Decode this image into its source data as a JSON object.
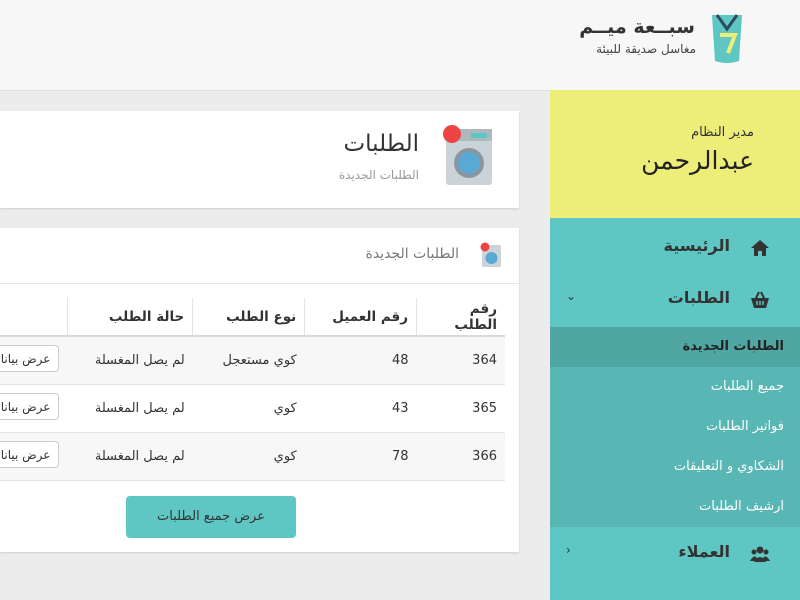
{
  "brand": {
    "name": "سبــعة ميــم",
    "tagline": "مغاسل صديقة للبيئة"
  },
  "profile": {
    "role": "مدير النظام",
    "name": "عبدالرحمن"
  },
  "sidebar": {
    "home_label": "الرئيسية",
    "orders_label": "الطلبات",
    "orders_sub": [
      "الطلبات الجديدة",
      "جميع الطلبات",
      "فواتير الطلبات",
      "الشكاوي و التعليقات",
      "ارشيف الطلبات"
    ],
    "clients_label": "العملاء"
  },
  "page": {
    "title": "الطلبات",
    "subtitle": "الطلبات الجديدة"
  },
  "panel": {
    "title": "الطلبات الجديدة"
  },
  "table": {
    "headers": [
      "رقم الطلب",
      "رقم العميل",
      "نوع الطلب",
      "حالة الطلب"
    ],
    "rows": [
      {
        "order_id": "364",
        "client_id": "48",
        "type": "كوي مستعجل",
        "status": "لم يصل المغسلة",
        "action": "عرض بيانات"
      },
      {
        "order_id": "365",
        "client_id": "43",
        "type": "كوي",
        "status": "لم يصل المغسلة",
        "action": "عرض بيانات"
      },
      {
        "order_id": "366",
        "client_id": "78",
        "type": "كوي",
        "status": "لم يصل المغسلة",
        "action": "عرض بيانات"
      }
    ]
  },
  "show_all_label": "عرض جميع الطلبات",
  "colors": {
    "teal": "#5ec6c3",
    "yellow": "#eded79",
    "badge_red": "#ee4444"
  },
  "icons": {
    "logo": "7m-logo-icon",
    "washer": "washing-machine-icon",
    "home": "home-icon",
    "basket": "basket-icon",
    "users": "users-icon"
  }
}
